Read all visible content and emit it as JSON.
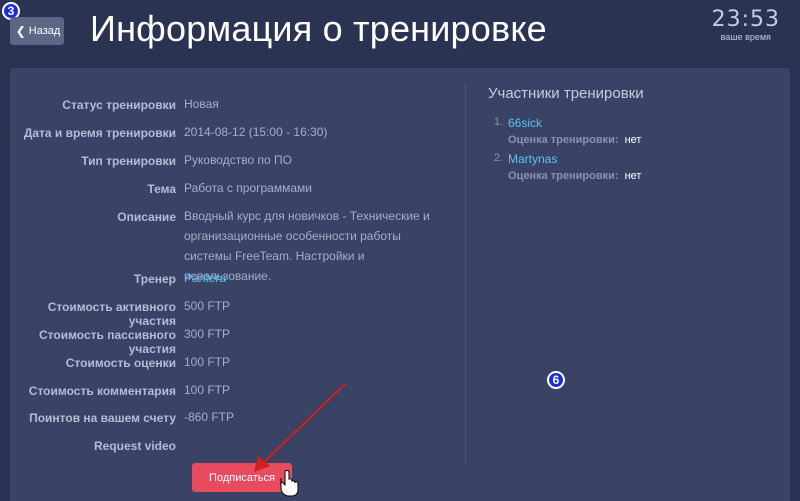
{
  "header": {
    "back_label": "Назад",
    "title": "Информация о тренировке",
    "clock_time": "23:53",
    "clock_label": "ваше время"
  },
  "badges": {
    "top_left": "3",
    "middle": "6"
  },
  "training": {
    "rows": [
      {
        "label": "Статус тренировки",
        "value": "Новая"
      },
      {
        "label": "Дата и время тренировки",
        "value": "2014-08-12 (15:00 - 16:30)"
      },
      {
        "label": "Тип тренировки",
        "value": "Руководство по ПО"
      },
      {
        "label": "Тема",
        "value": "Работа с программами"
      },
      {
        "label": "Описание",
        "value": "Вводный курс для новичков - Технические и организационные особенности работы системы FreeTeam. Настройки и использование."
      },
      {
        "label": "Тренер",
        "value": "Pantera"
      },
      {
        "label": "Стоимость активного участия",
        "value": "500 FTP"
      },
      {
        "label": "Стоимость пассивного участия",
        "value": "300 FTP"
      },
      {
        "label": "Стоимость оценки",
        "value": "100 FTP"
      },
      {
        "label": "Стоимость комментария",
        "value": "100 FTP"
      },
      {
        "label": "Поинтов на вашем счету",
        "value": "-860 FTP"
      },
      {
        "label": "Request video",
        "value": ""
      }
    ],
    "subscribe_label": "Подписаться"
  },
  "participants": {
    "title": "Участники тренировки",
    "items": [
      {
        "num": "1.",
        "name": "66sick",
        "rating_label": "Оценка тренировки:",
        "rating_value": "нет"
      },
      {
        "num": "2.",
        "name": "Martynas",
        "rating_label": "Оценка тренировки:",
        "rating_value": "нет"
      }
    ]
  },
  "colors": {
    "background": "#2b3352",
    "panel": "#3a4266",
    "accent_link": "#59c3f4",
    "button": "#e84a5f",
    "annotation_arrow": "#d0201c"
  }
}
